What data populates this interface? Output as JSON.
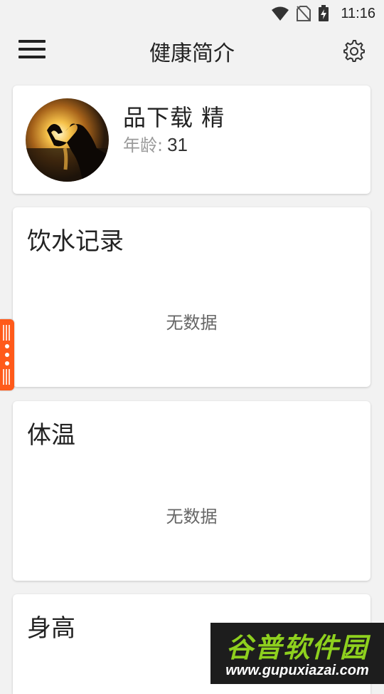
{
  "status_bar": {
    "time": "11:16"
  },
  "app_bar": {
    "title": "健康简介"
  },
  "profile": {
    "name": "品下载 精",
    "age_label": "年龄:",
    "age_value": "31"
  },
  "cards": [
    {
      "title": "饮水记录",
      "empty_text": "无数据"
    },
    {
      "title": "体温",
      "empty_text": "无数据"
    },
    {
      "title": "身高"
    }
  ],
  "watermark": {
    "title": "谷普软件园",
    "url": "www.gupuxiazai.com"
  },
  "colors": {
    "accent": "#ff5a1a",
    "background": "#f2f2f2",
    "card": "#ffffff",
    "watermark_green": "#8ed01e"
  }
}
